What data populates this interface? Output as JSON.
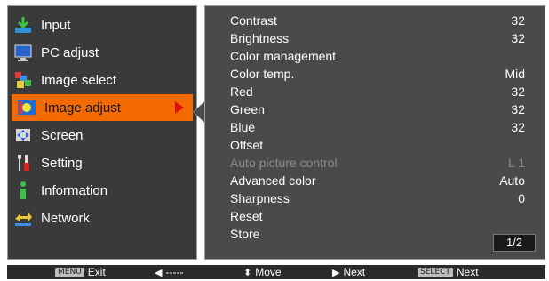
{
  "menu": {
    "items": [
      {
        "label": "Input",
        "icon": "input-icon"
      },
      {
        "label": "PC adjust",
        "icon": "pc-adjust-icon"
      },
      {
        "label": "Image select",
        "icon": "image-select-icon"
      },
      {
        "label": "Image adjust",
        "icon": "image-adjust-icon",
        "selected": true
      },
      {
        "label": "Screen",
        "icon": "screen-icon"
      },
      {
        "label": "Setting",
        "icon": "setting-icon"
      },
      {
        "label": "Information",
        "icon": "information-icon"
      },
      {
        "label": "Network",
        "icon": "network-icon"
      }
    ]
  },
  "settings": {
    "rows": [
      {
        "label": "Contrast",
        "value": "32"
      },
      {
        "label": "Brightness",
        "value": "32"
      },
      {
        "label": "Color management",
        "value": ""
      },
      {
        "label": "Color temp.",
        "value": "Mid"
      },
      {
        "label": "Red",
        "value": "32"
      },
      {
        "label": "Green",
        "value": "32"
      },
      {
        "label": "Blue",
        "value": "32"
      },
      {
        "label": "Offset",
        "value": ""
      },
      {
        "label": "Auto picture control",
        "value": "L 1",
        "disabled": true
      },
      {
        "label": "Advanced color",
        "value": "Auto"
      },
      {
        "label": "Sharpness",
        "value": "0"
      },
      {
        "label": "Reset",
        "value": ""
      },
      {
        "label": "Store",
        "value": ""
      }
    ],
    "page": "1/2"
  },
  "bottom_bar": {
    "exit_key": "MENU",
    "exit_label": "Exit",
    "back_label": "-----",
    "move_label": "Move",
    "next_label": "Next",
    "select_key": "SELECT",
    "select_label": "Next"
  },
  "colors": {
    "selected_bg": "#f26a00",
    "panel_bg": "#3a3a3a",
    "settings_bg": "#4a4a4a",
    "disabled_text": "#8a8a8a"
  }
}
